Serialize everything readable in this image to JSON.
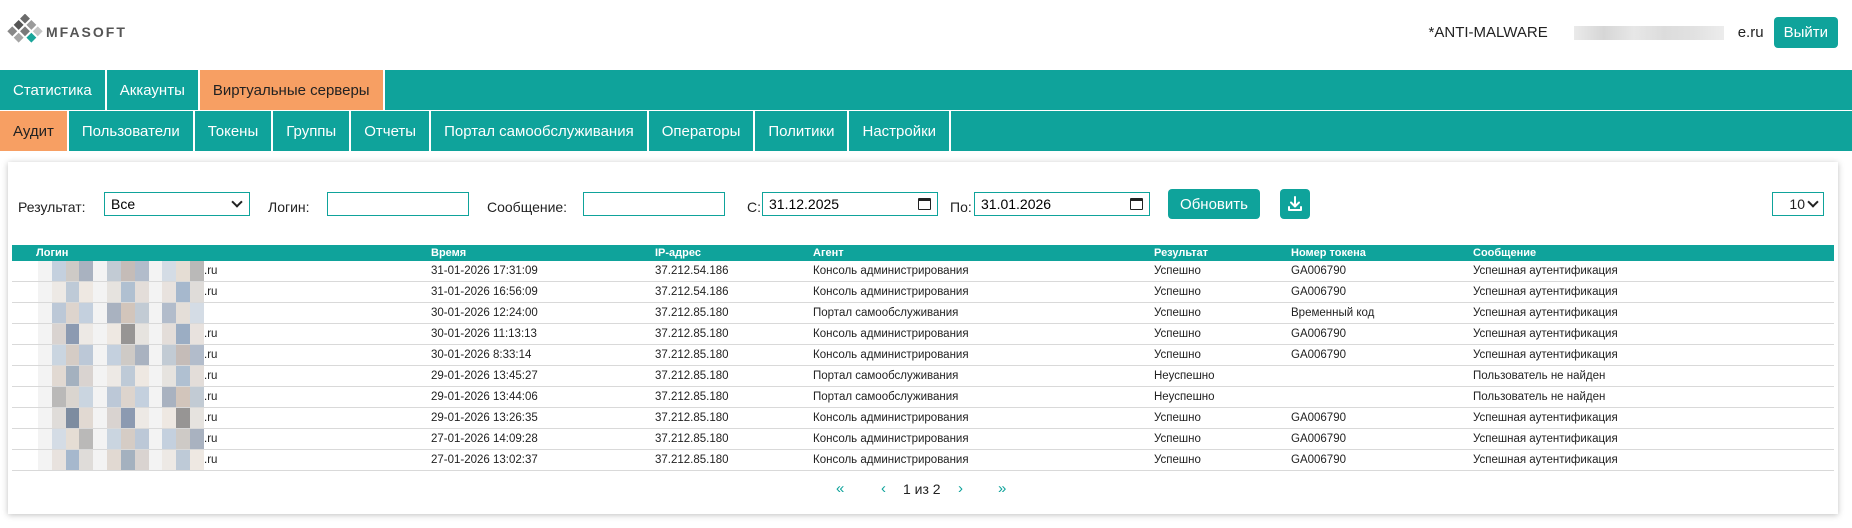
{
  "header": {
    "logo_text": "MFASOFT",
    "org": "*ANTI-MALWARE",
    "email_suffix": "e.ru",
    "logout_label": "Выйти"
  },
  "nav_main": [
    {
      "label": "Статистика",
      "active": false
    },
    {
      "label": "Аккаунты",
      "active": false
    },
    {
      "label": "Виртуальные серверы",
      "active": true
    }
  ],
  "nav_sub": [
    {
      "label": "Аудит",
      "active": true
    },
    {
      "label": "Пользователи",
      "active": false
    },
    {
      "label": "Токены",
      "active": false
    },
    {
      "label": "Группы",
      "active": false
    },
    {
      "label": "Отчеты",
      "active": false
    },
    {
      "label": "Портал самообслуживания",
      "active": false
    },
    {
      "label": "Операторы",
      "active": false
    },
    {
      "label": "Политики",
      "active": false
    },
    {
      "label": "Настройки",
      "active": false
    }
  ],
  "filters": {
    "result_label": "Результат:",
    "result_value": "Все",
    "login_label": "Логин:",
    "login_value": "",
    "message_label": "Сообщение:",
    "message_value": "",
    "from_label": "С:",
    "from_value": "31.12.2025",
    "to_label": "По:",
    "to_value": "31.01.2026",
    "refresh_label": "Обновить",
    "page_size": "10"
  },
  "table": {
    "headers": [
      "Логин",
      "Время",
      "IP-адрес",
      "Агент",
      "Результат",
      "Номер токена",
      "Сообщение"
    ],
    "rows": [
      {
        "login": ".ru",
        "time": "31-01-2026 17:31:09",
        "ip": "37.212.54.186",
        "agent": "Консоль администрирования",
        "result": "Успешно",
        "token": "GA006790",
        "message": "Успешная аутентификация"
      },
      {
        "login": ".ru",
        "time": "31-01-2026 16:56:09",
        "ip": "37.212.54.186",
        "agent": "Консоль администрирования",
        "result": "Успешно",
        "token": "GA006790",
        "message": "Успешная аутентификация"
      },
      {
        "login": "",
        "time": "30-01-2026 12:24:00",
        "ip": "37.212.85.180",
        "agent": "Портал самообслуживания",
        "result": "Успешно",
        "token": "Временный код",
        "message": "Успешная аутентификация"
      },
      {
        "login": ".ru",
        "time": "30-01-2026 11:13:13",
        "ip": "37.212.85.180",
        "agent": "Консоль администрирования",
        "result": "Успешно",
        "token": "GA006790",
        "message": "Успешная аутентификация"
      },
      {
        "login": ".ru",
        "time": "30-01-2026 8:33:14",
        "ip": "37.212.85.180",
        "agent": "Консоль администрирования",
        "result": "Успешно",
        "token": "GA006790",
        "message": "Успешная аутентификация"
      },
      {
        "login": ".ru",
        "time": "29-01-2026 13:45:27",
        "ip": "37.212.85.180",
        "agent": "Портал самообслуживания",
        "result": "Неуспешно",
        "token": "",
        "message": "Пользователь не найден"
      },
      {
        "login": ".ru",
        "time": "29-01-2026 13:44:06",
        "ip": "37.212.85.180",
        "agent": "Портал самообслуживания",
        "result": "Неуспешно",
        "token": "",
        "message": "Пользователь не найден"
      },
      {
        "login": ".ru",
        "time": "29-01-2026 13:26:35",
        "ip": "37.212.85.180",
        "agent": "Консоль администрирования",
        "result": "Успешно",
        "token": "GA006790",
        "message": "Успешная аутентификация"
      },
      {
        "login": ".ru",
        "time": "27-01-2026 14:09:28",
        "ip": "37.212.85.180",
        "agent": "Консоль администрирования",
        "result": "Успешно",
        "token": "GA006790",
        "message": "Успешная аутентификация"
      },
      {
        "login": ".ru",
        "time": "27-01-2026 13:02:37",
        "ip": "37.212.85.180",
        "agent": "Консоль администрирования",
        "result": "Успешно",
        "token": "GA006790",
        "message": "Успешная аутентификация"
      }
    ]
  },
  "pagination": {
    "first": "«",
    "prev": "‹",
    "text": "1 из 2",
    "next": "›",
    "last": "»"
  },
  "colors": {
    "accent": "#0fa39b",
    "active_tab": "#f79f63"
  }
}
